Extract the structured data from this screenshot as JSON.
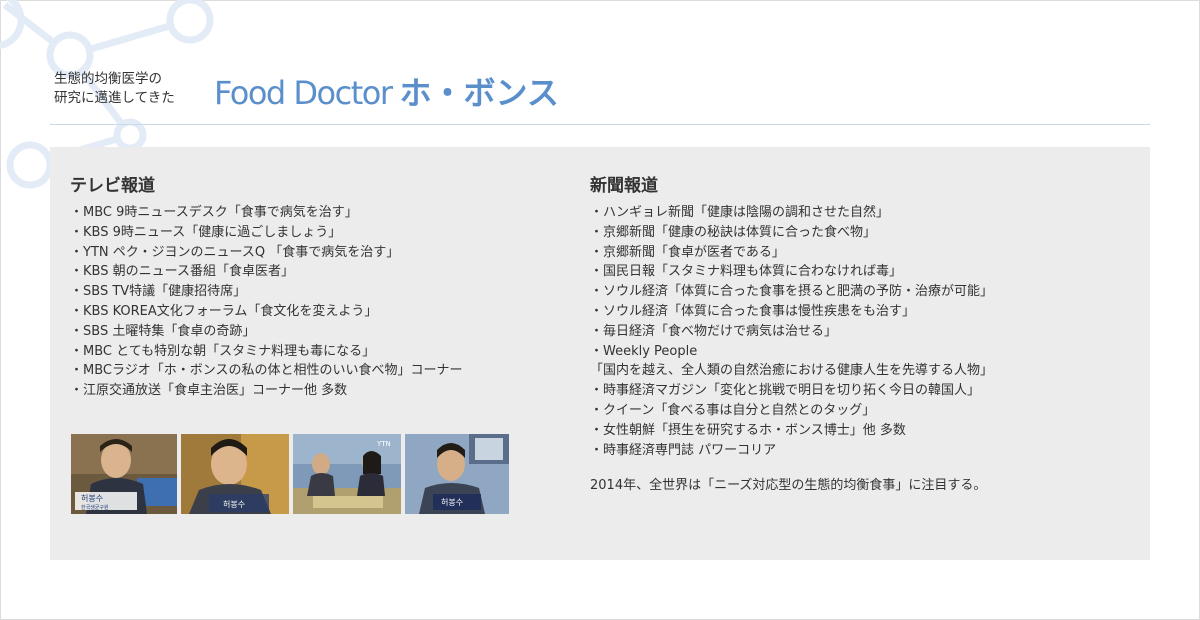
{
  "header": {
    "intro_line1": "生態的均衡医学の",
    "intro_line2": "研究に邁進してきた",
    "title_en": "Food Doctor",
    "title_jp": "ホ・ボンス"
  },
  "tv": {
    "heading": "テレビ報道",
    "items": [
      "・MBC 9時ニュースデスク「食事で病気を治す」",
      "・KBS 9時ニュース「健康に過ごしましょう」",
      "・YTN ペク・ジヨンのニュースQ 「食事で病気を治す」",
      "・KBS 朝のニュース番組「食卓医者」",
      "・SBS TV特議「健康招待席」",
      "・KBS KOREA文化フォーラム「食文化を変えよう」",
      "・SBS 土曜特集「食卓の奇跡」",
      "・MBC とても特別な朝「スタミナ料理も毒になる」",
      "・MBCラジオ「ホ・ボンスの私の体と相性のいい食べ物」コーナー",
      "・江原交通放送「食卓主治医」コーナー他 多数"
    ],
    "thumbnails": [
      {
        "name": "tv-thumbnail-1",
        "caption_name": "허봉수",
        "caption_sub": "한국생균구원"
      },
      {
        "name": "tv-thumbnail-2",
        "caption_name": "허봉수",
        "caption_sub": ""
      },
      {
        "name": "tv-thumbnail-3",
        "caption_name": "YTN",
        "caption_sub": ""
      },
      {
        "name": "tv-thumbnail-4",
        "caption_name": "허봉수",
        "caption_sub": ""
      }
    ]
  },
  "news": {
    "heading": "新聞報道",
    "items": [
      "・ハンギョレ新聞「健康は陰陽の調和させた自然」",
      "・京郷新聞「健康の秘訣は体質に合った食べ物」",
      "・京郷新聞「食卓が医者である」",
      "・国民日報「スタミナ料理も体質に合わなければ毒」",
      "・ソウル経済「体質に合った食事を摂ると肥満の予防・治療が可能」",
      "・ソウル経済「体質に合った食事は慢性疾患をも治す」",
      "・毎日経済「食べ物だけで病気は治せる」",
      "・Weekly People",
      "「国内を越え、全人類の自然治癒における健康人生を先導する人物」",
      "・時事経済マガジン「変化と挑戦で明日を切り拓く今日の韓国人」",
      "・クイーン「食べる事は自分と自然とのタッグ」",
      "・女性朝鮮「摂生を研究するホ・ボンス博士」他 多数",
      "・時事経済専門誌 パワーコリア"
    ],
    "note": "2014年、全世界は「ニーズ対応型の生態的均衡食事」に注目する。"
  },
  "colors": {
    "accent": "#5b8fcc",
    "panel_bg": "#ececec",
    "molecule": "#e3ecf6"
  }
}
